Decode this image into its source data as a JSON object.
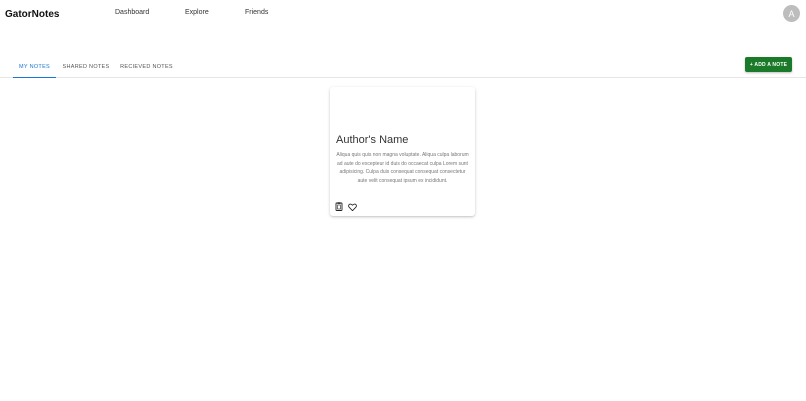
{
  "header": {
    "brand": "GatorNotes",
    "nav": [
      {
        "label": "Dashboard"
      },
      {
        "label": "Explore"
      },
      {
        "label": "Friends"
      }
    ],
    "avatar_initial": "A"
  },
  "tabs": [
    {
      "label": "MY NOTES",
      "active": true
    },
    {
      "label": "SHARED NOTES",
      "active": false
    },
    {
      "label": "RECIEVED NOTES",
      "active": false
    }
  ],
  "add_note_button": "+ ADD A NOTE",
  "card": {
    "title": "Author's Name",
    "body": "Aliqua quis quis non magna voluptate. Aliqua culpa laborum ad aute do excepteur id duis do occaecat culpa Lorem sunt adipisicing. Culpa duis consequat consequat consectetur aute velit consequat ipsum ex incididunt.",
    "actions": [
      {
        "icon": "clipboard-icon"
      },
      {
        "icon": "heart-icon"
      }
    ]
  },
  "colors": {
    "accent_blue": "#1976d2",
    "add_button_green": "#1b7a2a",
    "avatar_gray": "#bdbdbd"
  }
}
